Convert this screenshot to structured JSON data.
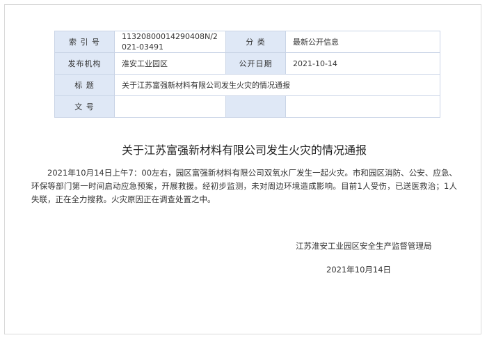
{
  "meta": {
    "index_label": "索 引 号",
    "index_value": "11320800014290408N/2021-03491",
    "category_label": "分    类",
    "category_value": "最新公开信息",
    "publisher_label": "发布机构",
    "publisher_value": "淮安工业园区",
    "date_label": "公开日期",
    "date_value": "2021-10-14",
    "subject_label": "标    题",
    "subject_value": "关于江苏富强新材料有限公司发生火灾的情况通报",
    "docno_label": "文    号",
    "docno_value": ""
  },
  "article": {
    "title": "关于江苏富强新材料有限公司发生火灾的情况通报",
    "body": "2021年10月14日上午7：00左右，园区富强新材料有限公司双氧水厂发生一起火灾。市和园区消防、公安、应急、环保等部门第一时间启动应急预案，开展救援。经初步监测，未对周边环境造成影响。目前1人受伤，已送医救治；1人失联，正在全力搜救。火灾原因正在调查处置之中。",
    "issuer": "江苏淮安工业园区安全生产监督管理局",
    "date": "2021年10月14日"
  }
}
